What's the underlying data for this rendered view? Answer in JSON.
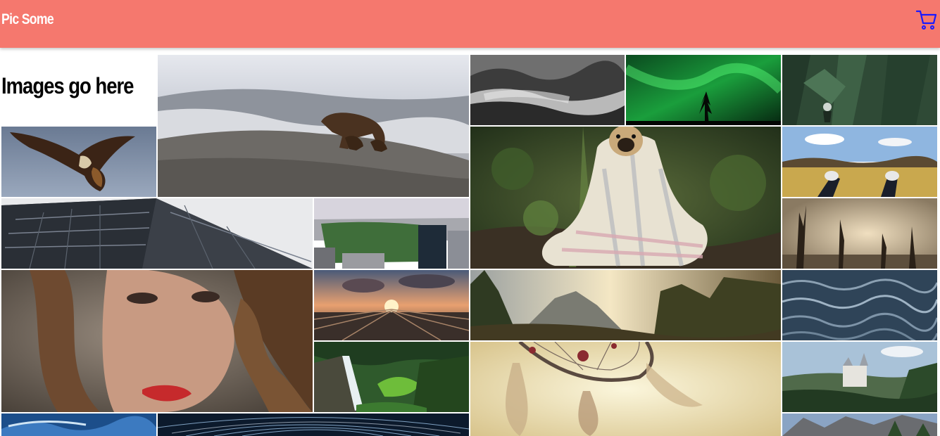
{
  "header": {
    "brand": "Pic Some",
    "cart_icon": "shopping-cart-icon",
    "background": "#f5786e",
    "cart_color": "#1a1aff"
  },
  "main": {
    "heading": "Images go here",
    "photos": [
      "eagle",
      "brown-bear-with-cubs",
      "misty-mountains",
      "northern-lights",
      "forest-hiker",
      "pug-in-blanket",
      "sneakers-on-field",
      "skyscraper-from-below",
      "central-park-city",
      "dead-trees-fog",
      "woman-portrait",
      "railway-sunset",
      "mountain-valley-sunset",
      "ocean-waves",
      "waterfall-forest",
      "dreamcatcher",
      "castle-in-forest",
      "blue-wave",
      "star-trails",
      "mountain-cliffs"
    ]
  }
}
